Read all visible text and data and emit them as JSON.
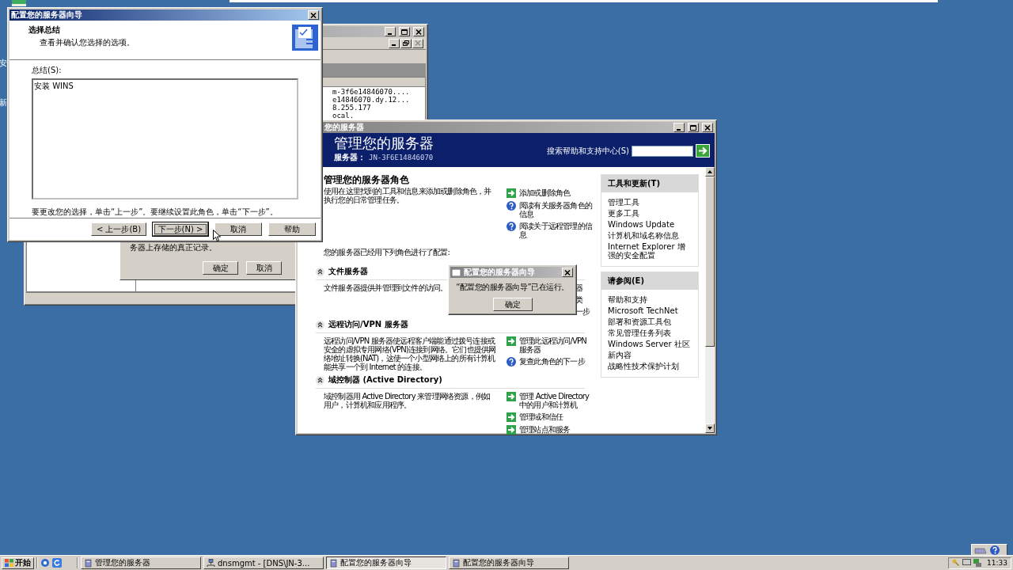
{
  "desktop": {
    "labels": [
      "安",
      "新"
    ]
  },
  "dns_window": {
    "lines": [
      "m-3f6e14846070....",
      "e14846070.dy.12...",
      "8.255.177",
      "ocal."
    ],
    "dialog": {
      "text": "务器上存储的真正记录。",
      "buttons": [
        "确定",
        "取消"
      ]
    }
  },
  "manage_window": {
    "title": "您的服务器",
    "header": {
      "title": "管理您的服务器",
      "server_label": "服务器：",
      "server_name": "JN-3F6E14846070",
      "search_label": "搜索帮助和支持中心(S)"
    },
    "heading": "管理您的服务器角色",
    "description": "使用在这里找到的工具和信息来添加或删除角色，并执行您的日常管理任务。",
    "links": [
      {
        "kind": "task",
        "text": "添加或删除角色"
      },
      {
        "kind": "info",
        "text": "阅读有关服务器角色的信息"
      },
      {
        "kind": "info",
        "text": "阅读关于远程管理的信息"
      }
    ],
    "configured_text": "您的服务器已经用下列角色进行了配置:",
    "roles": [
      {
        "title": "文件服务器",
        "description": "文件服务器提供并管理到文件的访问。",
        "links": [
          {
            "kind": "fragment",
            "text": "器"
          },
          {
            "kind": "fragment",
            "text": "类"
          },
          {
            "kind": "fragment",
            "text": "一步"
          }
        ]
      },
      {
        "title": "远程访问/VPN 服务器",
        "description": "远程访问/VPN 服务器使远程客户端能通过拨号连接或安全的虚拟专用网络(VPN)连接到网络。它们也提供网络地址转换(NAT)，这使一个小型网络上的所有计算机能共享一个到 Internet 的连接。",
        "links": [
          {
            "kind": "task",
            "text": "管理此远程访问/VPN 服务器"
          },
          {
            "kind": "info",
            "text": "复查此角色的下一步"
          }
        ]
      },
      {
        "title": "域控制器 (Active Directory)",
        "description": "域控制器用 Active Directory 来管理网络资源，例如用户，计算机和应用程序。",
        "links": [
          {
            "kind": "task",
            "text": "管理 Active Directory 中的用户和计算机"
          },
          {
            "kind": "task",
            "text": "管理域和信任"
          },
          {
            "kind": "task",
            "text": "管理站点和服务"
          }
        ]
      }
    ],
    "panels": [
      {
        "title": "工具和更新(T)",
        "items": [
          "管理工具",
          "更多工具",
          "Windows Update",
          "计算机和域名称信息",
          "Internet Explorer 增强的安全配置"
        ]
      },
      {
        "title": "请参阅(E)",
        "items": [
          "帮助和支持",
          "Microsoft TechNet",
          "部署和资源工具包",
          "常见管理任务列表",
          "Windows Server 社区",
          "新内容",
          "战略性技术保护计划"
        ]
      }
    ]
  },
  "wizard": {
    "title": "配置您的服务器向导",
    "step_title": "选择总结",
    "step_subtitle": "查看并确认您选择的选项。",
    "summary_label": "总结(S):",
    "summary": "安装 WINS",
    "note": "要更改您的选择，单击“上一步”。要继续设置此角色，单击“下一步”。",
    "buttons": [
      {
        "label": "< 上一步(B)",
        "focused": false
      },
      {
        "label": "下一步(N) >",
        "focused": true
      },
      {
        "label": "取消",
        "focused": false
      },
      {
        "label": "帮助",
        "focused": false
      }
    ]
  },
  "message_box": {
    "title": "配置您的服务器向导",
    "text": "“配置您的服务器向导”已在运行。",
    "button": "确定"
  },
  "taskbar": {
    "start": "开始",
    "tasks": [
      {
        "kind": "app",
        "label": "管理您的服务器",
        "selected": false
      },
      {
        "kind": "console",
        "label": "dnsmgmt - [DNS\\JN-3...",
        "selected": false
      },
      {
        "kind": "app",
        "label": "配置您的服务器向导",
        "selected": true
      },
      {
        "kind": "app",
        "label": "配置您的服务器向导",
        "selected": false
      }
    ],
    "clock": "11:33"
  }
}
